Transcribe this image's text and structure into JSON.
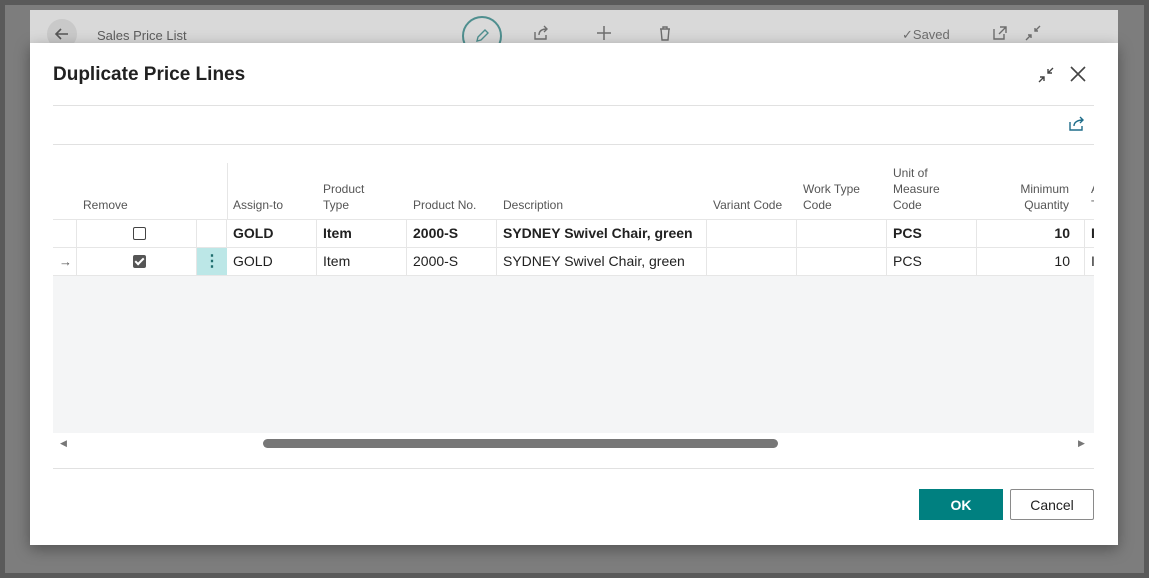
{
  "background": {
    "page_title": "Sales Price List",
    "saved_label": "✓Saved",
    "icons": [
      "back-arrow-icon",
      "edit-pencil-icon",
      "share-icon",
      "add-icon",
      "delete-icon",
      "open-new-window-icon",
      "collapse-icon"
    ]
  },
  "dialog": {
    "title": "Duplicate Price Lines",
    "columns": {
      "remove": "Remove",
      "assign_to": "Assign-to",
      "product_type_1": "Product",
      "product_type_2": "Type",
      "product_no": "Product No.",
      "description": "Description",
      "variant_code": "Variant Code",
      "work_type_1": "Work Type",
      "work_type_2": "Code",
      "uom_1": "Unit of",
      "uom_2": "Measure",
      "uom_3": "Code",
      "min_qty_1": "Minimum",
      "min_qty_2": "Quantity",
      "partial_1": "A",
      "partial_2": "T"
    },
    "rows": [
      {
        "remove": false,
        "assign_to": "GOLD",
        "product_type": "Item",
        "product_no": "2000-S",
        "description": "SYDNEY Swivel Chair, green",
        "variant_code": "",
        "work_type_code": "",
        "uom": "PCS",
        "min_qty": "10",
        "next": "I",
        "bold": true
      },
      {
        "remove": true,
        "assign_to": "GOLD",
        "product_type": "Item",
        "product_no": "2000-S",
        "description": "SYDNEY Swivel Chair, green",
        "variant_code": "",
        "work_type_code": "",
        "uom": "PCS",
        "min_qty": "10",
        "next": "I",
        "bold": false,
        "row_marker": "→",
        "menu": "⋮"
      }
    ],
    "ok_label": "OK",
    "cancel_label": "Cancel"
  },
  "colors": {
    "accent": "#008080",
    "selection": "#bce7e7",
    "grid_background": "#f4f5f6"
  }
}
